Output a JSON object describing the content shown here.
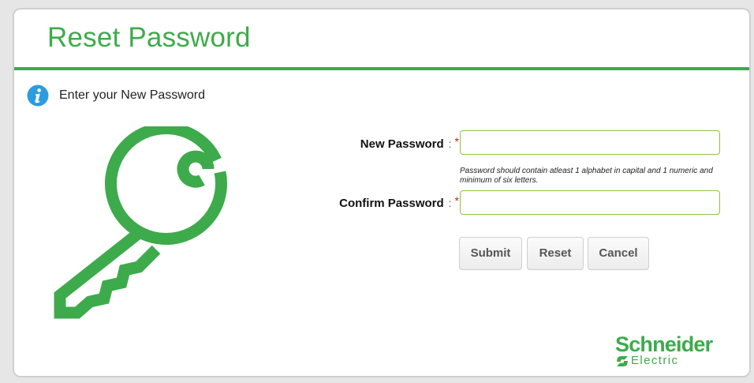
{
  "page": {
    "title": "Reset Password",
    "info_text": "Enter your New Password"
  },
  "form": {
    "new_password": {
      "label": "New Password",
      "separator": ":",
      "required_mark": "*",
      "value": ""
    },
    "hint": "Password should contain atleast 1 alphabet in capital and 1 numeric and minimum of six letters.",
    "confirm_password": {
      "label": "Confirm Password",
      "separator": ":",
      "required_mark": "*",
      "value": ""
    }
  },
  "buttons": {
    "submit": "Submit",
    "reset": "Reset",
    "cancel": "Cancel"
  },
  "brand": {
    "name": "Schneider",
    "sub": "Electric"
  },
  "icons": {
    "info": "info-icon",
    "key": "key-icon",
    "brand_mark": "schneider-logo-icon"
  },
  "colors": {
    "accent_green": "#3dab4b",
    "input_border": "#8cc63f",
    "info_blue": "#2d9be0",
    "required_red": "#d0201a"
  }
}
